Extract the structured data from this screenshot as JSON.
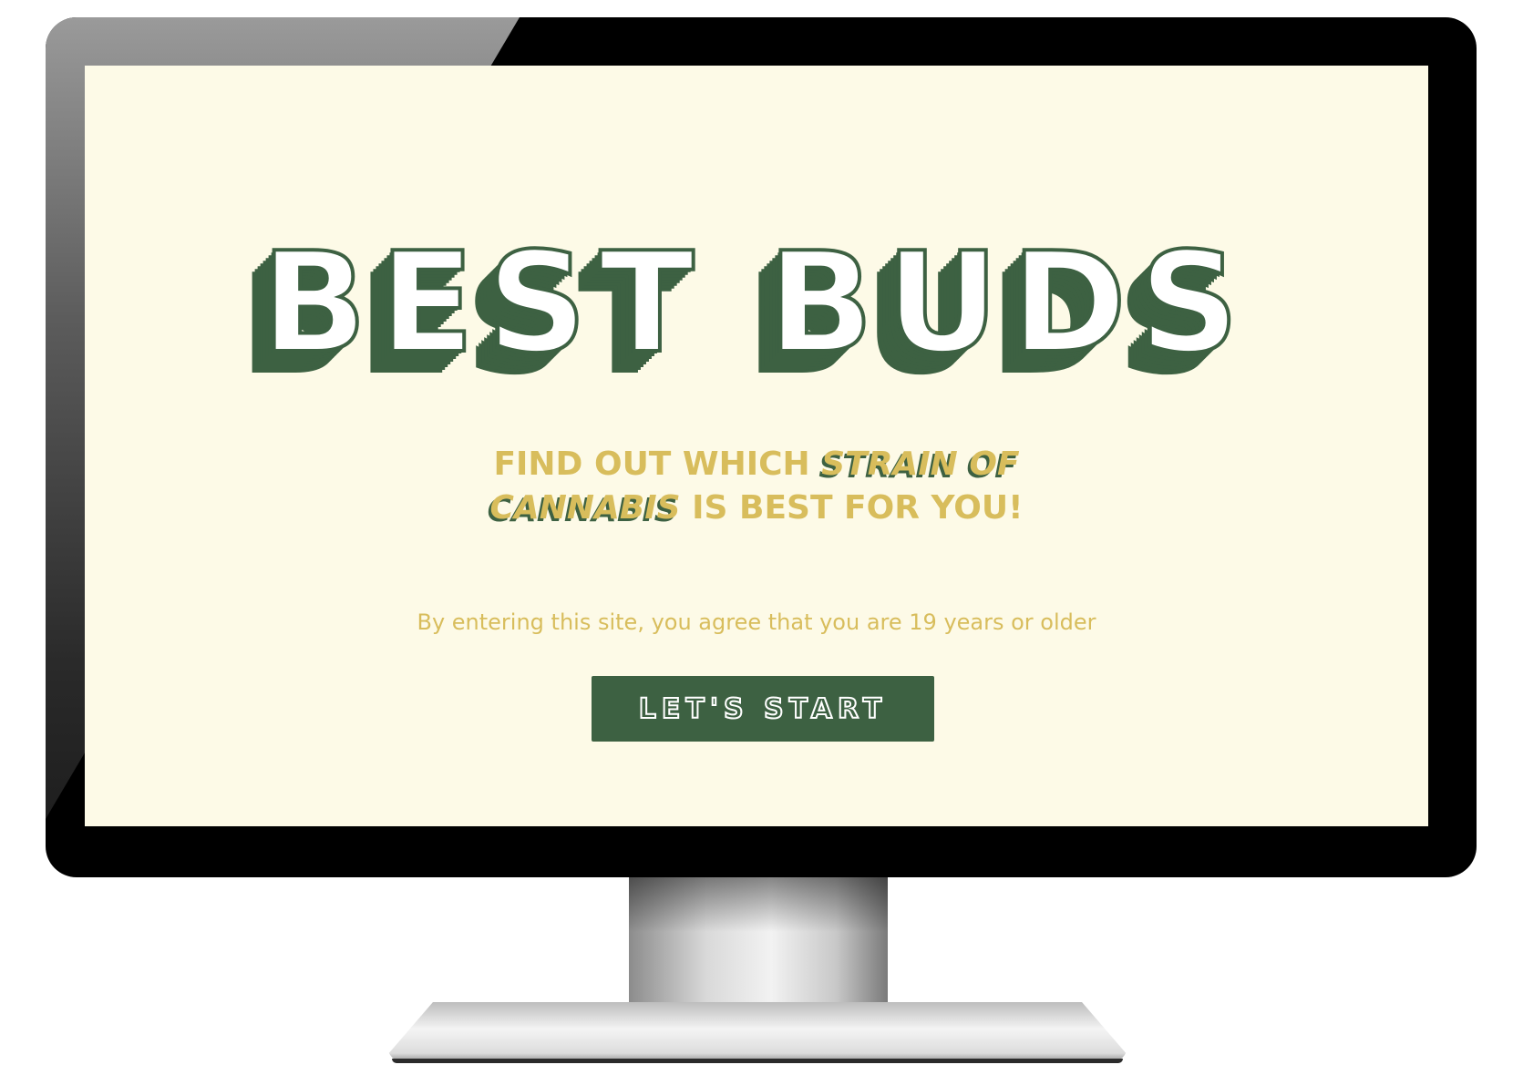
{
  "landing": {
    "brand_title": "BEST BUDS",
    "tagline": {
      "part1": "FIND OUT WHICH ",
      "emphasis": "STRAIN OF CANNABIS",
      "part2": " IS BEST FOR YOU!"
    },
    "disclaimer": "By entering this site, you agree that you are 19 years or older",
    "start_button_label": "LET'S START"
  },
  "colors": {
    "background": "#fdfae7",
    "brand_green": "#3d6142",
    "accent_gold": "#d8bd5c"
  }
}
